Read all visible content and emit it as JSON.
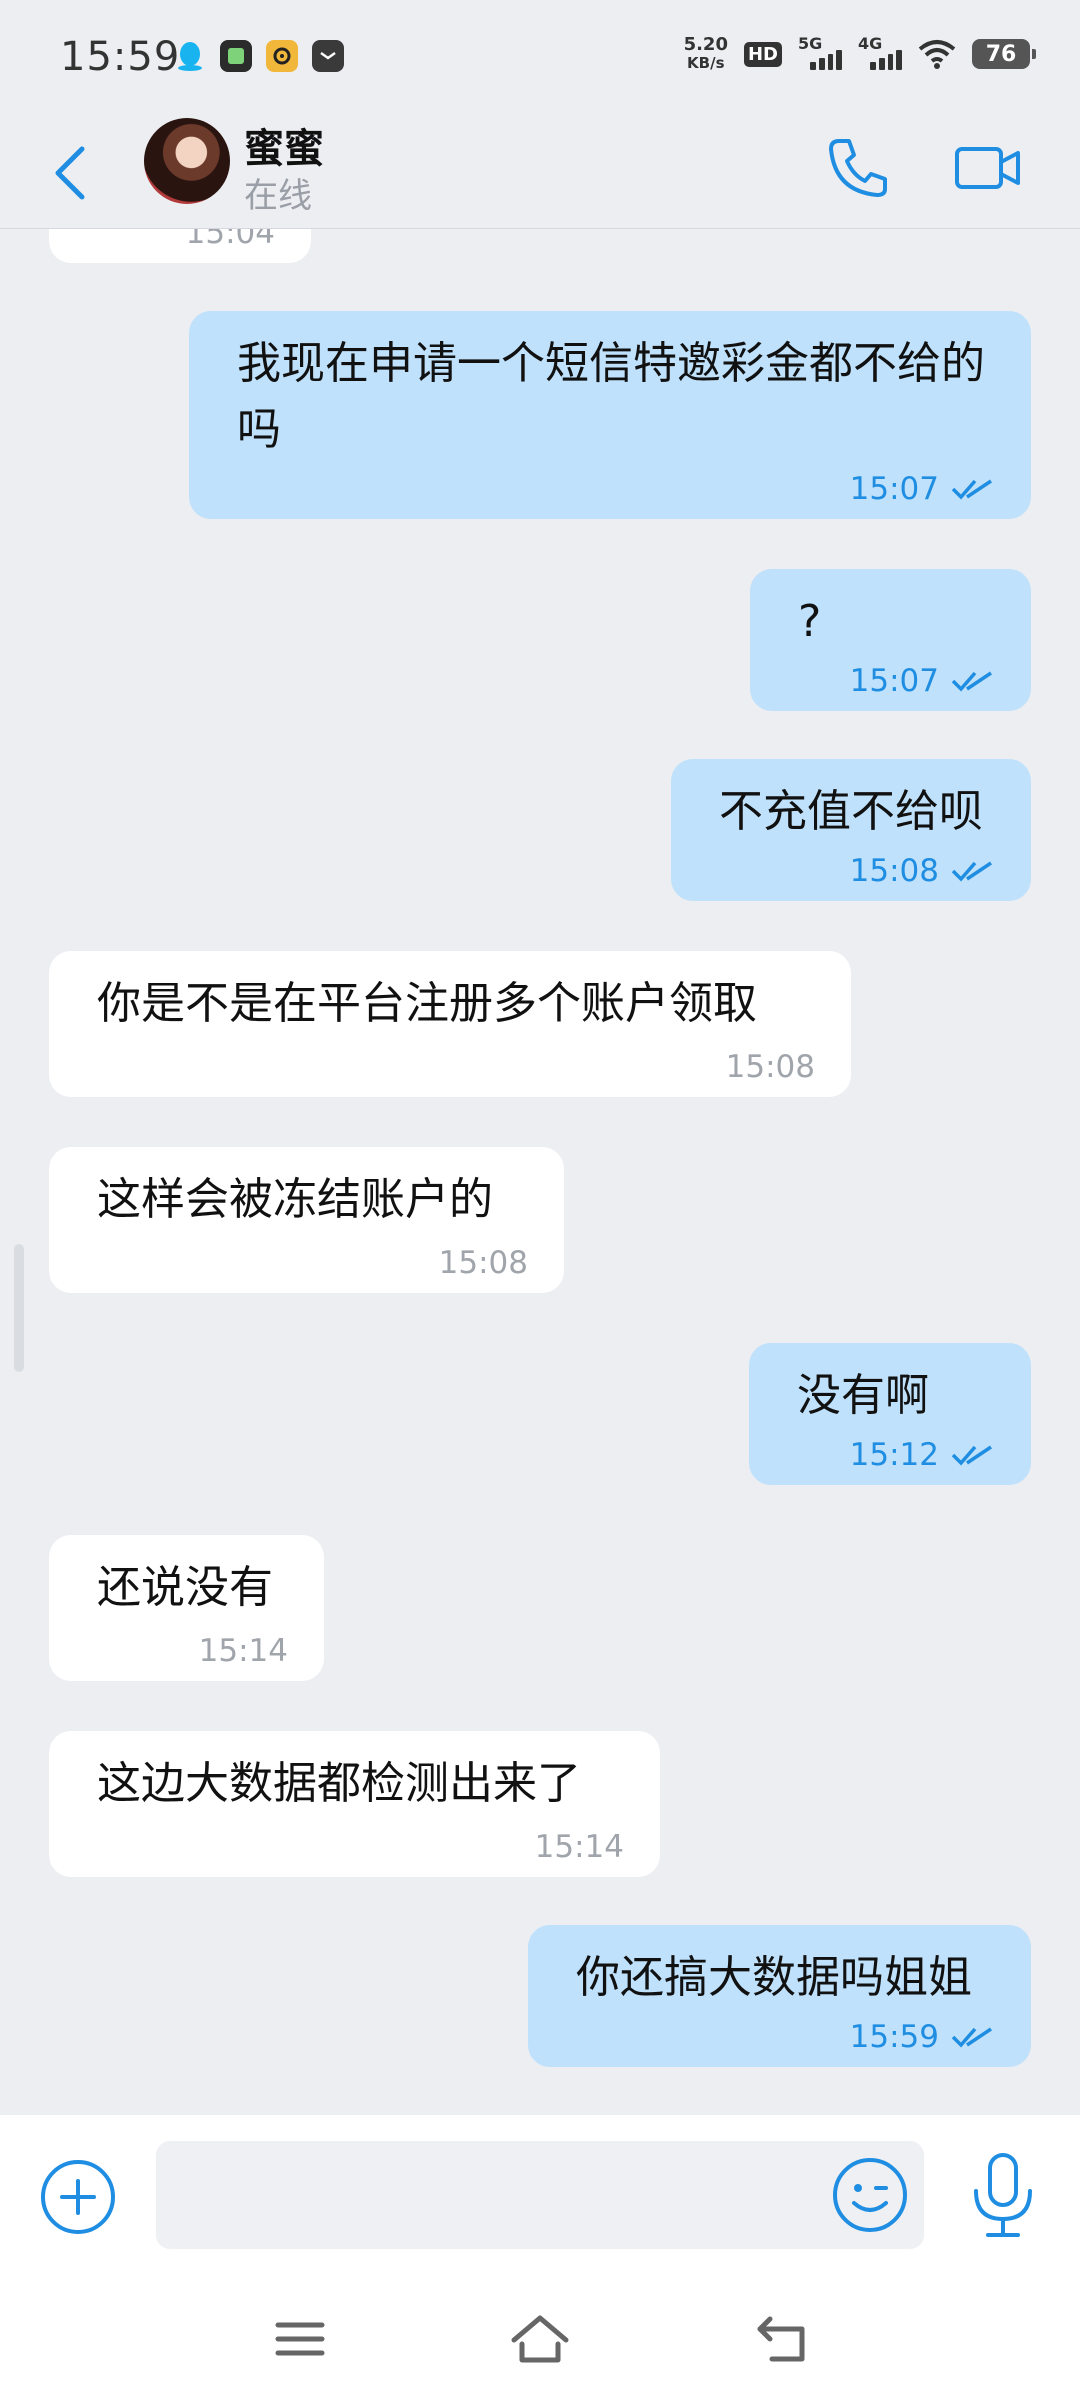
{
  "status_bar": {
    "time": "15:59",
    "net_speed_value": "5.20",
    "net_speed_unit": "KB/s",
    "hd_label": "HD",
    "sim1_label": "5G",
    "sim2_label": "4G",
    "battery": "76",
    "notification_icons": [
      "qq-icon",
      "app-icon",
      "app-icon",
      "message-icon"
    ]
  },
  "header": {
    "contact_name": "蜜蜜",
    "contact_status": "在线"
  },
  "messages": [
    {
      "dir": "in",
      "text": "",
      "time": "15:04"
    },
    {
      "dir": "out",
      "text": "我现在申请一个短信特邀彩金都不给的吗",
      "time": "15:07"
    },
    {
      "dir": "out",
      "text": "?",
      "time": "15:07"
    },
    {
      "dir": "out",
      "text": "不充值不给呗",
      "time": "15:08"
    },
    {
      "dir": "in",
      "text": "你是不是在平台注册多个账户领取",
      "time": "15:08"
    },
    {
      "dir": "in",
      "text": "这样会被冻结账户的",
      "time": "15:08"
    },
    {
      "dir": "out",
      "text": "没有啊",
      "time": "15:12"
    },
    {
      "dir": "in",
      "text": "还说没有",
      "time": "15:14"
    },
    {
      "dir": "in",
      "text": "这边大数据都检测出来了",
      "time": "15:14"
    },
    {
      "dir": "out",
      "text": "你还搞大数据吗姐姐",
      "time": "15:59"
    }
  ],
  "input": {
    "value": "",
    "placeholder": ""
  },
  "colors": {
    "accent": "#1f8ee2",
    "outgoing_bubble": "#bfe1fb",
    "incoming_bubble": "#ffffff",
    "background": "#eceef2"
  }
}
